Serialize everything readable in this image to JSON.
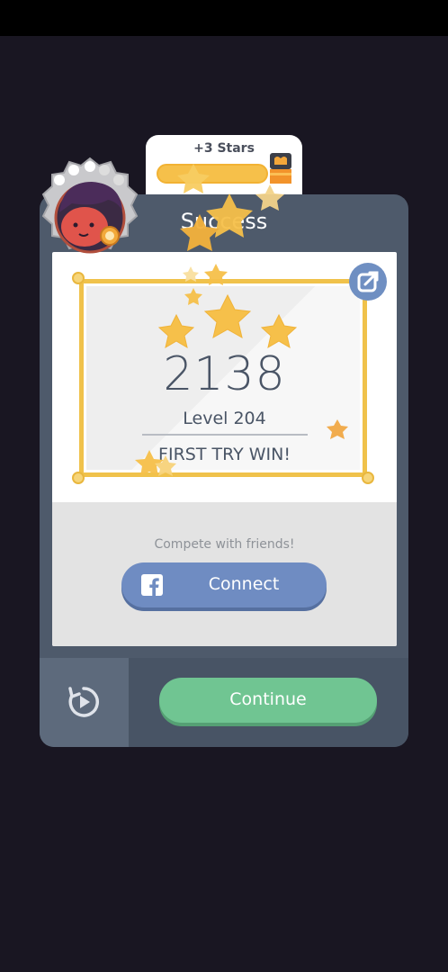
{
  "reward": {
    "title": "+3 Stars",
    "bar_fill": 0.8,
    "chest": "chest-icon"
  },
  "result": {
    "title": "Success",
    "score": "2138",
    "level": "Level 204",
    "subtitle": "FIRST TRY WIN!",
    "stars_earned": 3,
    "share_icon": "share-icon"
  },
  "social": {
    "prompt": "Compete with friends!",
    "connect_label": "Connect",
    "connect_icon": "facebook-icon"
  },
  "actions": {
    "replay_icon": "replay-icon",
    "continue_label": "Continue"
  },
  "avatar": {
    "icon": "avatar-portrait"
  },
  "colors": {
    "background": "#191622",
    "panel": "#4e5a6b",
    "star_gold": "#f6c04a",
    "facebook_blue": "#6f8cc2",
    "continue_green": "#70c592"
  }
}
